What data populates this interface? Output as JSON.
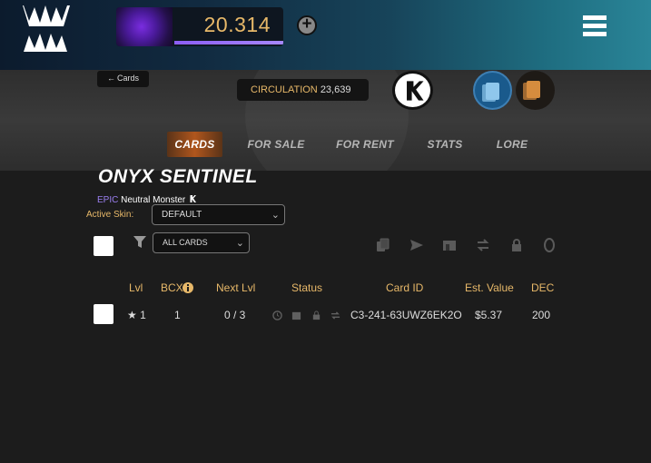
{
  "header": {
    "balance": "20.314",
    "balance_progress": 0.7,
    "add_icon": "plus-circle-icon",
    "menu_icon": "hamburger-menu-icon"
  },
  "nav": {
    "back_label": "Cards",
    "circulation_label": "CIRCULATION",
    "circulation_value": "23,639",
    "tabs": [
      "CARDS",
      "FOR SALE",
      "FOR RENT",
      "STATS",
      "LORE"
    ],
    "active_tab": "CARDS"
  },
  "card": {
    "name": "ONYX SENTINEL",
    "rarity": "EPIC",
    "type": "Neutral Monster",
    "active_skin_label": "Active Skin:",
    "active_skin_value": "DEFAULT"
  },
  "filters": {
    "filter_value": "ALL CARDS"
  },
  "table": {
    "headers": [
      "Lvl",
      "BCX",
      "Next Lvl",
      "Status",
      "Card ID",
      "Est. Value",
      "DEC"
    ],
    "rows": [
      {
        "lvl": "★ 1",
        "bcx": "1",
        "next": "0 / 3",
        "card_id": "C3-241-63UWZ6EK2O",
        "value": "$5.37",
        "dec": "200"
      }
    ]
  },
  "colors": {
    "accent": "#e7b869",
    "epic": "#9a7ff0",
    "tab_active": "#b0561d"
  }
}
